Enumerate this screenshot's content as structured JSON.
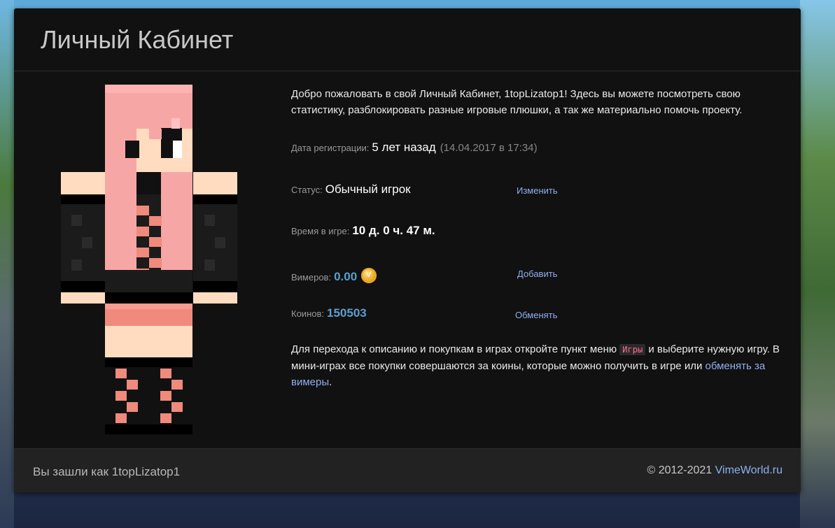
{
  "header": {
    "title": "Личный Кабинет"
  },
  "welcome": {
    "text": "Добро пожаловать в свой Личный Кабинет, 1topLizatop1! Здесь вы можете посмотреть свою статистику, разблокировать разные игровые плюшки, а так же материально помочь проекту."
  },
  "stats": {
    "registration": {
      "label": "Дата регистрации:",
      "value": "5 лет назад",
      "detail": "(14.04.2017 в 17:34)"
    },
    "status": {
      "label": "Статус:",
      "value": "Обычный игрок",
      "action": "Изменить"
    },
    "playtime": {
      "label": "Время в игре:",
      "value": "10 д. 0 ч. 47 м."
    },
    "vimers": {
      "label": "Вимеров:",
      "value": "0.00",
      "action": "Добавить",
      "icon": "coin-icon"
    },
    "coins": {
      "label": "Коинов:",
      "value": "150503",
      "action": "Обменять"
    }
  },
  "bottom": {
    "part1": "Для перехода к описанию и покупкам в играх откройте пункт меню",
    "badge": "Игры",
    "part2": "и выберите нужную игру. В мини-играх все покупки совершаются за коины, которые можно получить в игре или",
    "link": "обменять за вимеры",
    "end": "."
  },
  "footer": {
    "logged_in": "Вы зашли как 1topLizatop1",
    "copyright": "© 2012-2021",
    "brand": "VimeWorld.ru"
  },
  "colors": {
    "panel": "#111111",
    "footer": "#222222",
    "link": "#8fb0f0",
    "coins": "#5aa0cf",
    "skin_pink": "#f7a4a4",
    "skin_salmon": "#f08a7c"
  }
}
